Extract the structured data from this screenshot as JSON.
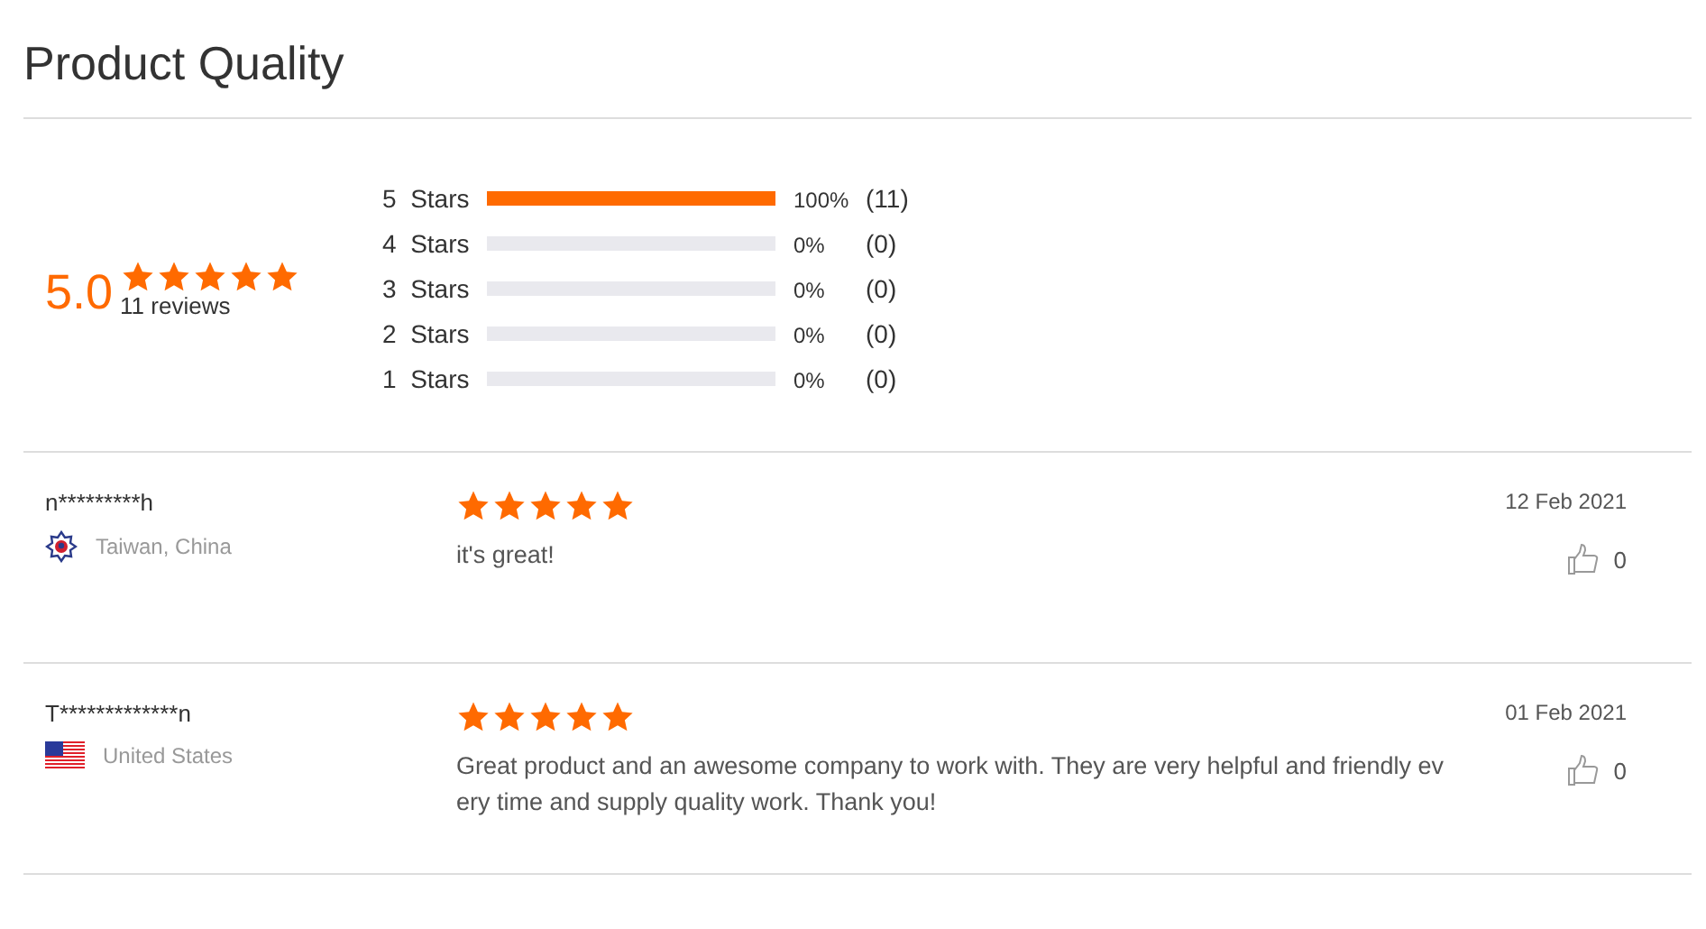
{
  "title": "Product Quality",
  "summary": {
    "score": "5.0",
    "stars": 5,
    "reviews": "11 reviews"
  },
  "breakdown": [
    {
      "label": "5  Stars",
      "level": 1,
      "percent": "100%",
      "count": "(11)"
    },
    {
      "label": "4  Stars",
      "level": 0,
      "percent": "0%",
      "count": "(0)"
    },
    {
      "label": "3  Stars",
      "level": 0,
      "percent": "0%",
      "count": "(0)"
    },
    {
      "label": "2  Stars",
      "level": 0,
      "percent": "0%",
      "count": "(0)"
    },
    {
      "label": "1  Stars",
      "level": 0,
      "percent": "0%",
      "count": "(0)"
    }
  ],
  "reviews": [
    {
      "user": "n*********h",
      "kind": "emblem",
      "country": "Taiwan, China",
      "stars": 5,
      "text": "it's great!",
      "date": "12 Feb 2021",
      "likes": "0"
    },
    {
      "user": "T*************n",
      "kind": "stripes",
      "country": "United States",
      "stars": 5,
      "text": "Great product and an awesome company to work with. They are very helpful and friendly every time and supply quality work. Thank you!",
      "date": "01 Feb 2021",
      "likes": "0"
    }
  ]
}
